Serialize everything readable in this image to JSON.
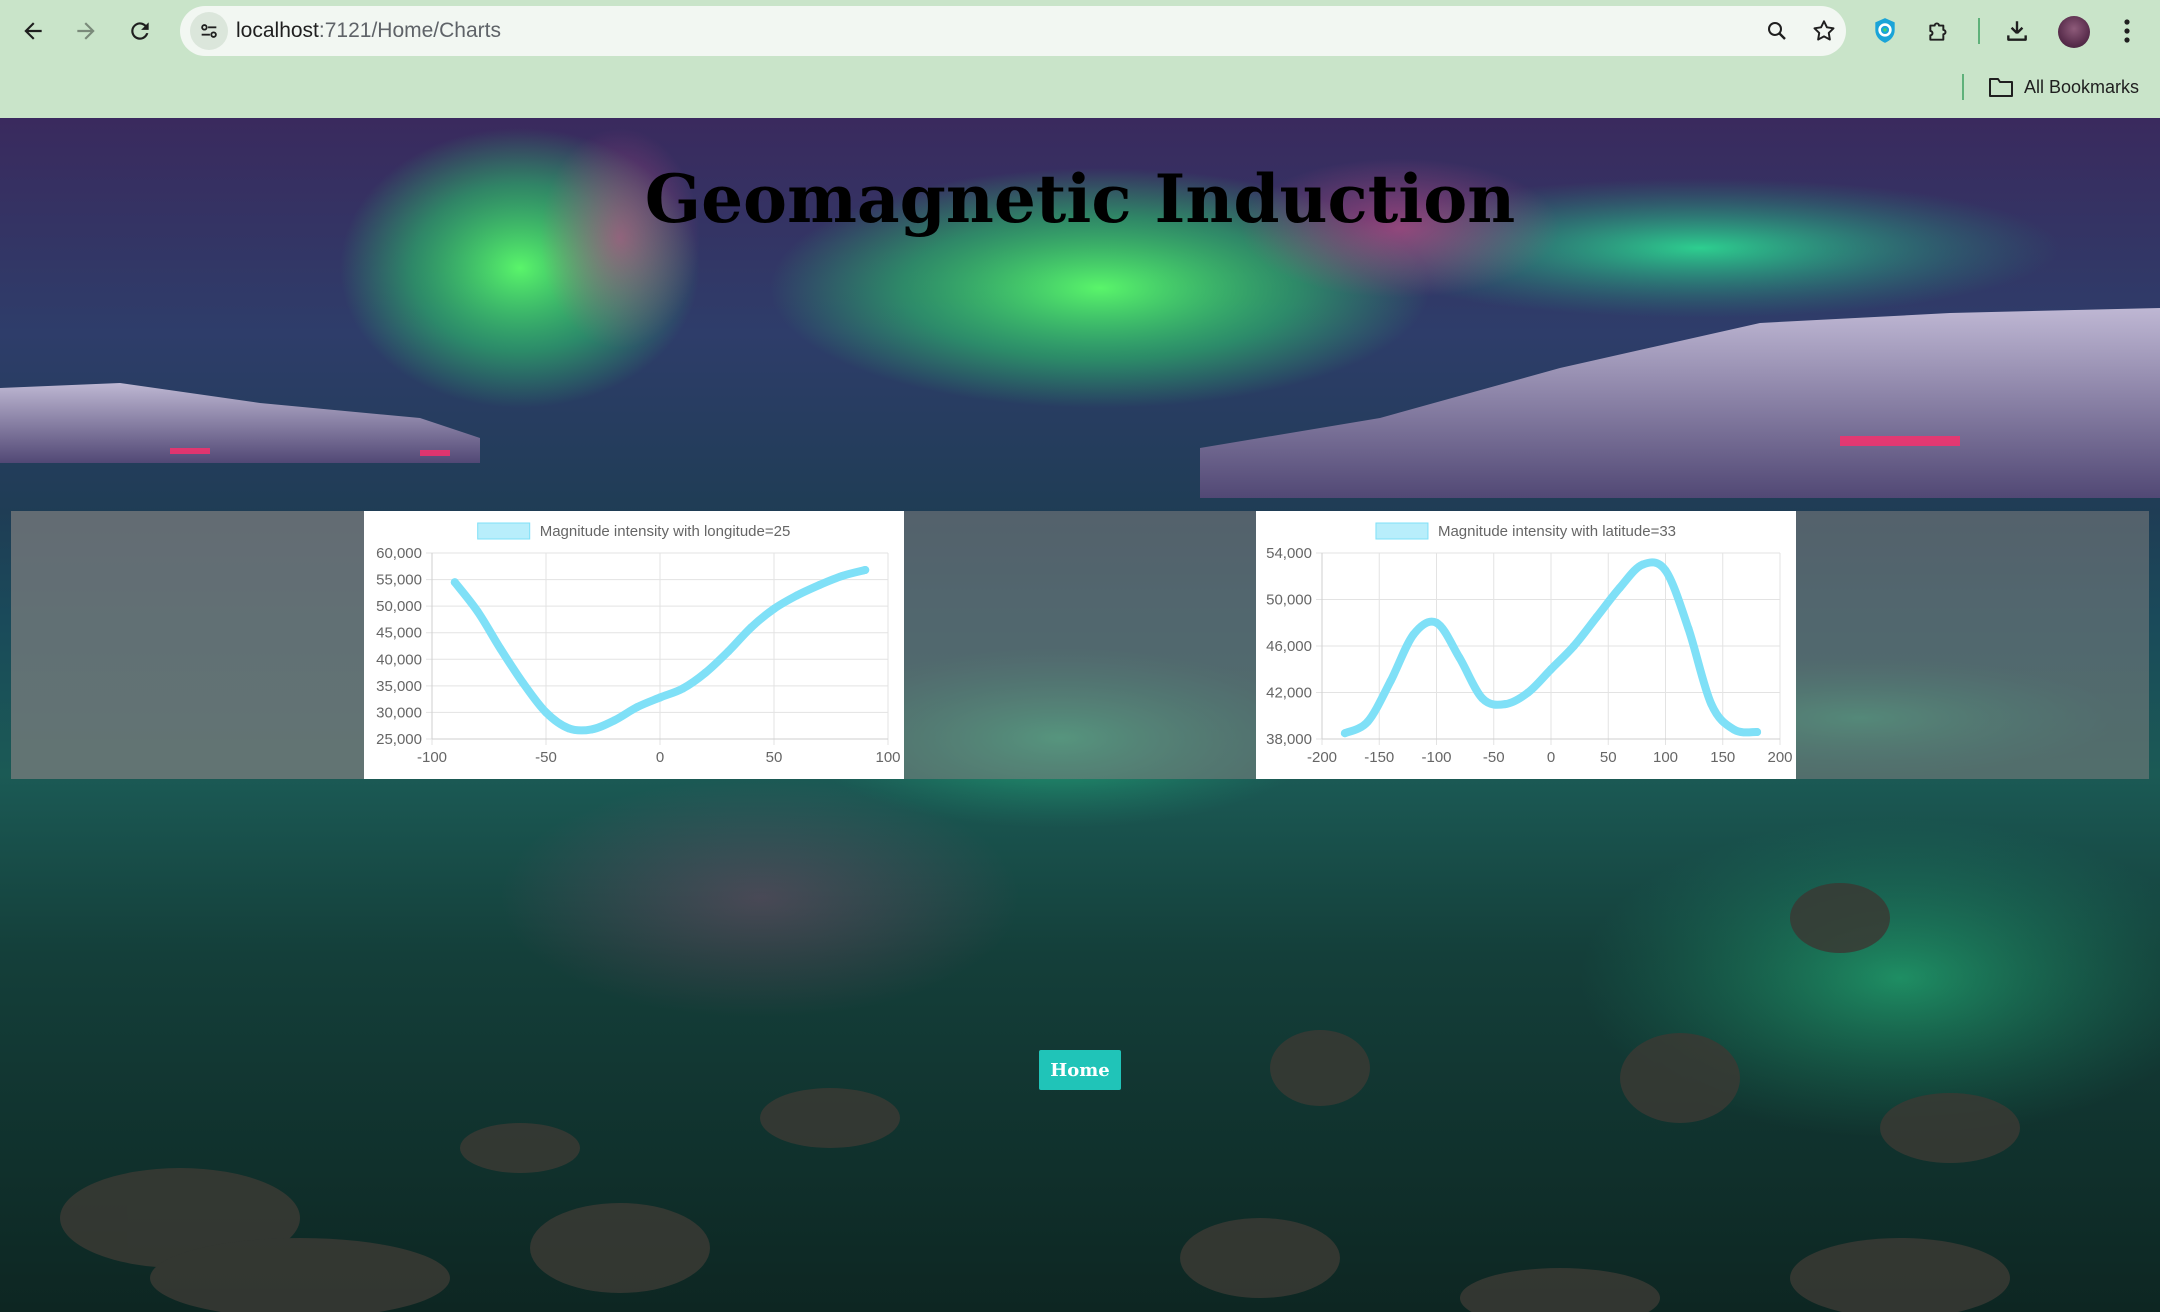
{
  "browser": {
    "url_host": "localhost",
    "url_path": ":7121/Home/Charts",
    "bookmarks_label": "All Bookmarks",
    "icons": [
      "back-icon",
      "forward-icon",
      "reload-icon",
      "site-info-icon",
      "zoom-icon",
      "star-icon",
      "shield-extension-icon",
      "puzzle-icon",
      "download-icon",
      "avatar",
      "kebab-menu-icon",
      "folder-icon"
    ]
  },
  "page": {
    "title": "Geomagnetic Induction",
    "home_label": "Home"
  },
  "colors": {
    "line": "#7fe0f7",
    "legend_box": "#b8eefb",
    "accent_button": "#20c4b8"
  },
  "chart_data": [
    {
      "type": "line",
      "legend": "Magnitude intensity with longitude=25",
      "x": [
        -90,
        -80,
        -70,
        -60,
        -50,
        -40,
        -30,
        -20,
        -10,
        0,
        10,
        20,
        30,
        40,
        50,
        60,
        70,
        80,
        90
      ],
      "y": [
        54500,
        49000,
        42000,
        35500,
        30000,
        27000,
        26800,
        28500,
        31000,
        32800,
        34500,
        37500,
        41500,
        46000,
        49500,
        52000,
        54000,
        55700,
        56800
      ],
      "xlim": [
        -100,
        100
      ],
      "ylim": [
        25000,
        60000
      ],
      "x_ticks": [
        "-100",
        "-50",
        "0",
        "50",
        "100"
      ],
      "y_ticks": [
        "60,000",
        "55,000",
        "50,000",
        "45,000",
        "40,000",
        "35,000",
        "30,000",
        "25,000"
      ],
      "grid": true,
      "legend_position": "top"
    },
    {
      "type": "line",
      "legend": "Magnitude intensity with latitude=33",
      "x": [
        -180,
        -160,
        -140,
        -120,
        -100,
        -80,
        -60,
        -40,
        -20,
        0,
        20,
        40,
        60,
        80,
        100,
        120,
        140,
        160,
        180
      ],
      "y": [
        38500,
        39500,
        43000,
        47000,
        48000,
        45000,
        41500,
        41000,
        42000,
        44000,
        46000,
        48500,
        51000,
        53000,
        52500,
        47500,
        41000,
        38800,
        38600
      ],
      "xlim": [
        -200,
        200
      ],
      "ylim": [
        38000,
        54000
      ],
      "x_ticks": [
        "-200",
        "-150",
        "-100",
        "-50",
        "0",
        "50",
        "100",
        "150",
        "200"
      ],
      "y_ticks": [
        "54,000",
        "50,000",
        "46,000",
        "42,000",
        "38,000"
      ],
      "grid": true,
      "legend_position": "top"
    }
  ]
}
